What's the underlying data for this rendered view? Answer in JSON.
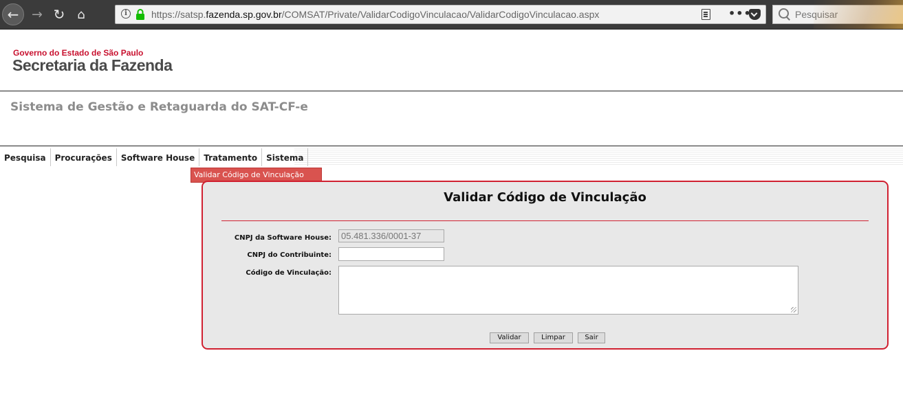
{
  "browser": {
    "url_prefix": "https://satsp.",
    "url_domain": "fazenda.sp.gov.br",
    "url_path": "/COMSAT/Private/ValidarCodigoVinculacao/ValidarCodigoVinculacao.aspx",
    "search_placeholder": "Pesquisar",
    "icons": {
      "back": "←",
      "forward": "→",
      "reload": "↻",
      "home": "⌂",
      "info": "i",
      "more": "•••"
    },
    "lock_color": "#12bc00"
  },
  "header": {
    "gov_text": "Governo do Estado de São Paulo",
    "sec_text": "Secretaria da Fazenda",
    "system_title": "Sistema de Gestão e Retaguarda do SAT-CF-e",
    "accent_color": "#c8102e"
  },
  "menu": {
    "items": [
      "Pesquisa",
      "Procurações",
      "Software House",
      "Tratamento",
      "Sistema"
    ],
    "dropdown_item": "Validar Código de Vinculação"
  },
  "panel": {
    "title": "Validar Código de Vinculação",
    "border_color": "#d02030",
    "fields": {
      "software_house_label": "CNPJ da Software House:",
      "software_house_value": "05.481.336/0001-37",
      "contribuinte_label": "CNPJ do Contribuinte:",
      "contribuinte_value": "",
      "codigo_label": "Código de Vinculação:",
      "codigo_value": ""
    },
    "buttons": {
      "validar": "Validar",
      "limpar": "Limpar",
      "sair": "Sair"
    }
  }
}
